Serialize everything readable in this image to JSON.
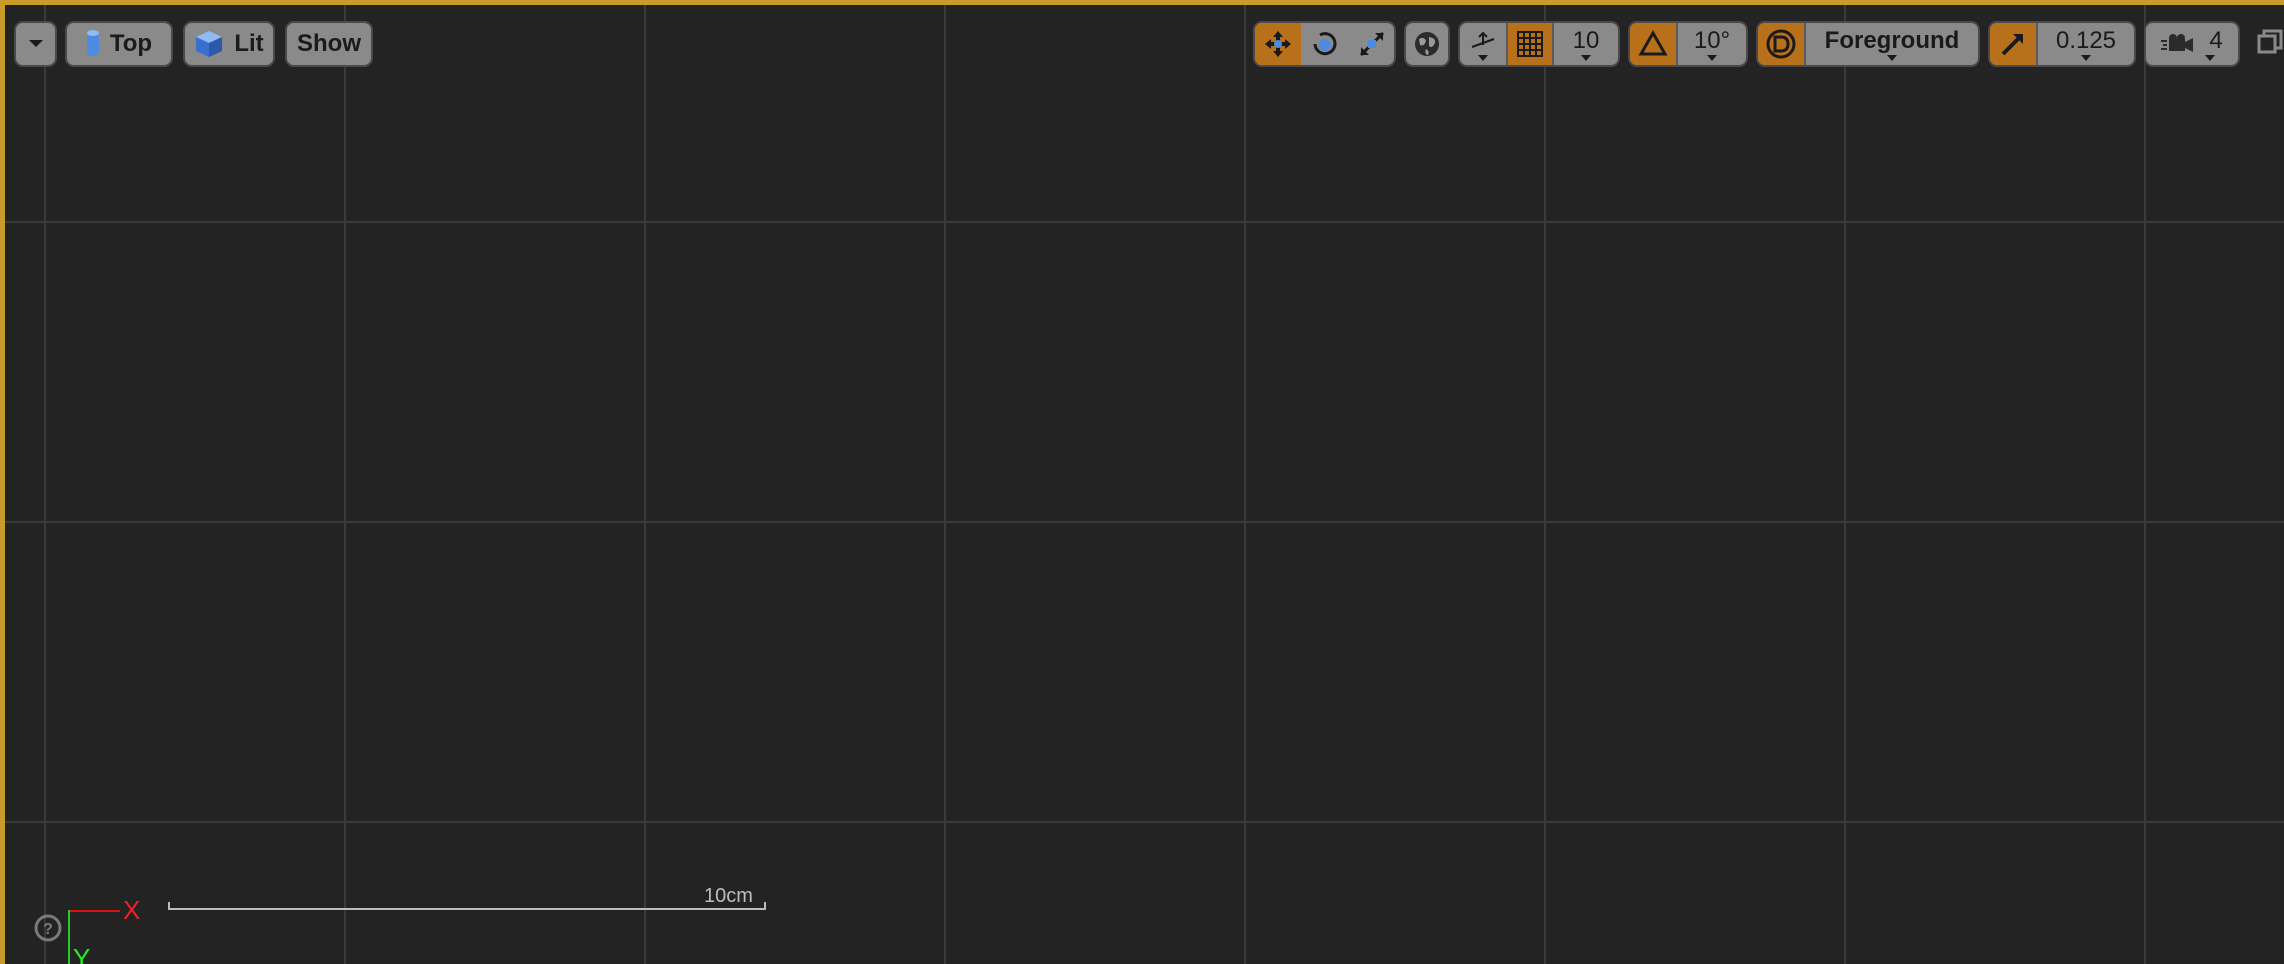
{
  "toolbar_left": {
    "view_mode_label": "Top",
    "lighting_label": "Lit",
    "show_label": "Show"
  },
  "toolbar_right": {
    "grid_snap_value": "10",
    "rotation_snap_value": "10°",
    "layer_label": "Foreground",
    "scale_snap_value": "0.125",
    "camera_speed_value": "4"
  },
  "viewport": {
    "scale_bar_label": "10cm",
    "axis_x_label": "X",
    "axis_y_label": "Y"
  },
  "colors": {
    "accent": "#b8711a",
    "frame": "#c89b2b",
    "axis_x": "#dd2222",
    "axis_y": "#22dd22"
  },
  "icons": {
    "view_options": "chevron-down-icon",
    "view_mode": "cylinder-icon",
    "lighting": "cube-icon",
    "translate": "move-icon",
    "rotate": "rotate-icon",
    "scale": "scale-icon",
    "coordinate_space": "globe-icon",
    "surface_snap": "surface-snap-icon",
    "grid_snap": "grid-icon",
    "rotation_snap": "angle-icon",
    "layer": "layer-icon",
    "scale_snap": "scale-arrow-icon",
    "camera_speed": "camera-icon",
    "maximize": "maximize-icon",
    "help": "help-icon"
  }
}
